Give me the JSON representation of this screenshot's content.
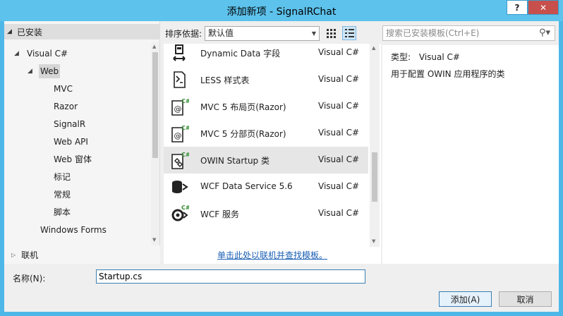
{
  "window": {
    "title": "添加新项 - SignalRChat",
    "help": "?",
    "close": "✕"
  },
  "left": {
    "installed": "已安装",
    "tree": [
      {
        "label": "Visual C#",
        "level": 0,
        "expanded": true
      },
      {
        "label": "Web",
        "level": 1,
        "expanded": true,
        "selected": true
      },
      {
        "label": "MVC",
        "level": 2
      },
      {
        "label": "Razor",
        "level": 2
      },
      {
        "label": "SignalR",
        "level": 2
      },
      {
        "label": "Web API",
        "level": 2
      },
      {
        "label": "Web 窗体",
        "level": 2
      },
      {
        "label": "标记",
        "level": 2
      },
      {
        "label": "常规",
        "level": 2
      },
      {
        "label": "脚本",
        "level": 2
      },
      {
        "label": "Windows Forms",
        "level": 1
      }
    ],
    "online": "联机"
  },
  "toolbar": {
    "sort_label": "排序依据:",
    "sort_value": "默认值"
  },
  "templates": [
    {
      "name": "Dynamic Data 字段",
      "lang": "Visual C#",
      "icon": "dynamic-data-icon"
    },
    {
      "name": "LESS 样式表",
      "lang": "Visual C#",
      "icon": "less-icon"
    },
    {
      "name": "MVC 5 布局页(Razor)",
      "lang": "Visual C#",
      "icon": "razor-icon"
    },
    {
      "name": "MVC 5 分部页(Razor)",
      "lang": "Visual C#",
      "icon": "razor-icon"
    },
    {
      "name": "OWIN Startup 类",
      "lang": "Visual C#",
      "icon": "owin-icon",
      "selected": true
    },
    {
      "name": "WCF Data Service 5.6",
      "lang": "Visual C#",
      "icon": "wcf-data-icon"
    },
    {
      "name": "WCF 服务",
      "lang": "Visual C#",
      "icon": "wcf-service-icon"
    }
  ],
  "online_link": "单击此处以联机并查找模板。",
  "search": {
    "placeholder": "搜索已安装模板(Ctrl+E)"
  },
  "details": {
    "type_label": "类型:",
    "type_value": "Visual C#",
    "description": "用于配置 OWIN 应用程序的类"
  },
  "bottom": {
    "name_label": "名称(N):",
    "name_value": "Startup.cs",
    "add": "添加(A)",
    "cancel": "取消"
  }
}
